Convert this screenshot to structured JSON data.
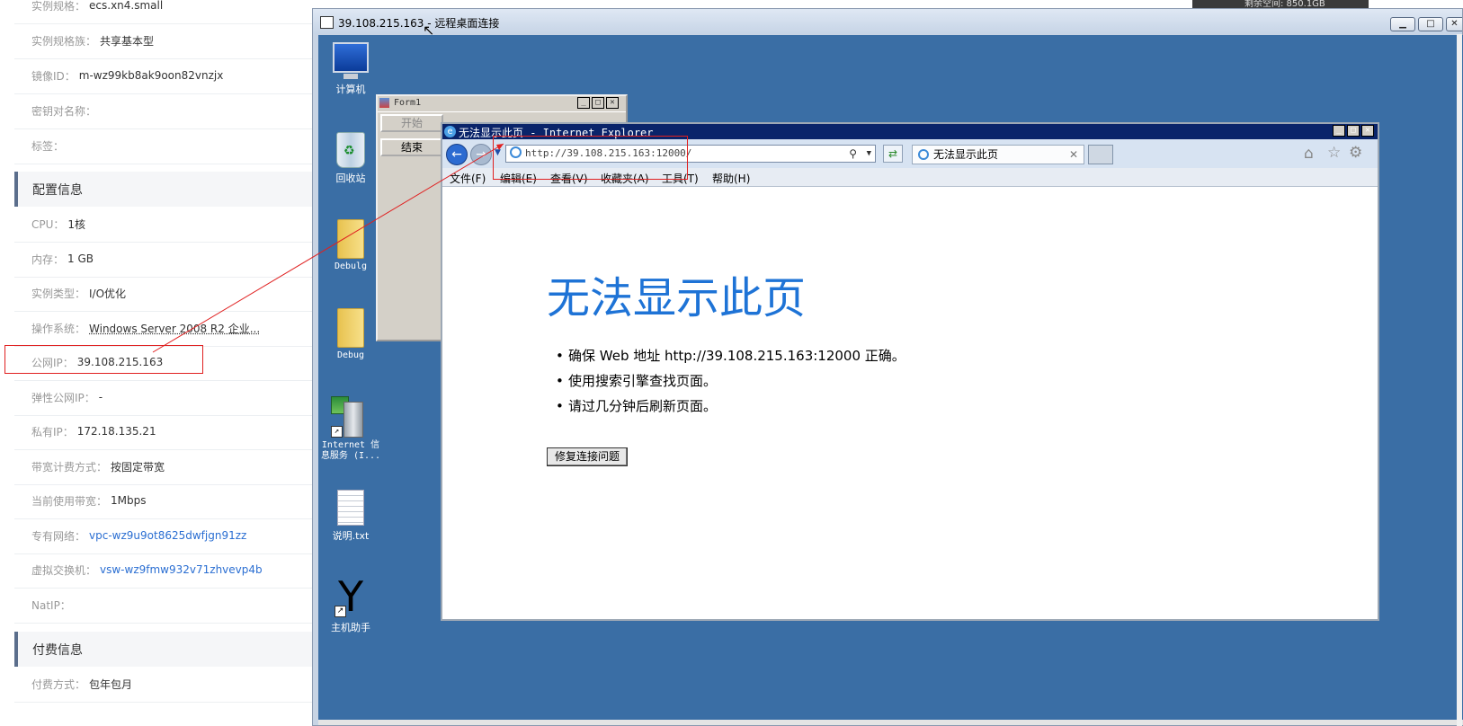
{
  "console": {
    "rows": [
      {
        "label": "实例规格：",
        "value": "ecs.xn4.small"
      },
      {
        "label": "实例规格族：",
        "value": "共享基本型"
      },
      {
        "label": "镜像ID：",
        "value": "m-wz99kb8ak9oon82vnzjx"
      },
      {
        "label": "密钥对名称：",
        "value": ""
      },
      {
        "label": "标签：",
        "value": ""
      },
      {
        "label": "CPU：",
        "value": "1核"
      },
      {
        "label": "内存：",
        "value": "1 GB"
      },
      {
        "label": "实例类型：",
        "value": "I/O优化"
      },
      {
        "label": "操作系统：",
        "value": "Windows Server 2008 R2 企业..."
      },
      {
        "label": "公网IP：",
        "value": "39.108.215.163"
      },
      {
        "label": "弹性公网IP：",
        "value": "-"
      },
      {
        "label": "私有IP：",
        "value": "172.18.135.21"
      },
      {
        "label": "带宽计费方式：",
        "value": "按固定带宽"
      },
      {
        "label": "当前使用带宽：",
        "value": "1Mbps"
      },
      {
        "label": "专有网络：",
        "value": "vpc-wz9u9ot8625dwfjgn91zz"
      },
      {
        "label": "虚拟交换机：",
        "value": "vsw-wz9fmw932v71zhvevp4b"
      },
      {
        "label": "NatIP：",
        "value": ""
      },
      {
        "label": "付费方式：",
        "value": "包年包月"
      }
    ],
    "sections": {
      "config": "配置信息",
      "billing": "付费信息"
    },
    "topright": "剩余空间: 850.1GB"
  },
  "rdp": {
    "title": "39.108.215.163 - 远程桌面连接",
    "controls": {
      "min": "▁",
      "max": "□",
      "close": "✕"
    }
  },
  "desktop_icons": [
    {
      "label": "计算机",
      "icon": "computer-icon"
    },
    {
      "label": "回收站",
      "icon": "recycle-bin-icon"
    },
    {
      "label": "Debulg",
      "icon": "folder-icon"
    },
    {
      "label": "Debug",
      "icon": "folder-icon"
    },
    {
      "label": "Internet 信息服务 (I...",
      "icon": "iis-server-icon"
    },
    {
      "label": "说明.txt",
      "icon": "text-file-icon"
    },
    {
      "label": "主机助手",
      "icon": "y-app-icon"
    }
  ],
  "form1": {
    "title": "Form1",
    "start_button": "开始",
    "end_button": "结束"
  },
  "ie": {
    "title": "无法显示此页 - Internet Explorer",
    "address": "http://39.108.215.163:12000/",
    "address_host": "39.108.215.163",
    "tab_title": "无法显示此页",
    "menu": [
      "文件(F)",
      "编辑(E)",
      "查看(V)",
      "收藏夹(A)",
      "工具(T)",
      "帮助(H)"
    ],
    "error_heading": "无法显示此页",
    "error_items": [
      "确保 Web 地址 http://39.108.215.163:12000 正确。",
      "使用搜索引擎查找页面。",
      "请过几分钟后刷新页面。"
    ],
    "fix_button": "修复连接问题"
  },
  "colors": {
    "accent": "#1e73d6",
    "desktop": "#3a6ea5",
    "annotation": "#e02020",
    "link": "#2a6ed2"
  }
}
